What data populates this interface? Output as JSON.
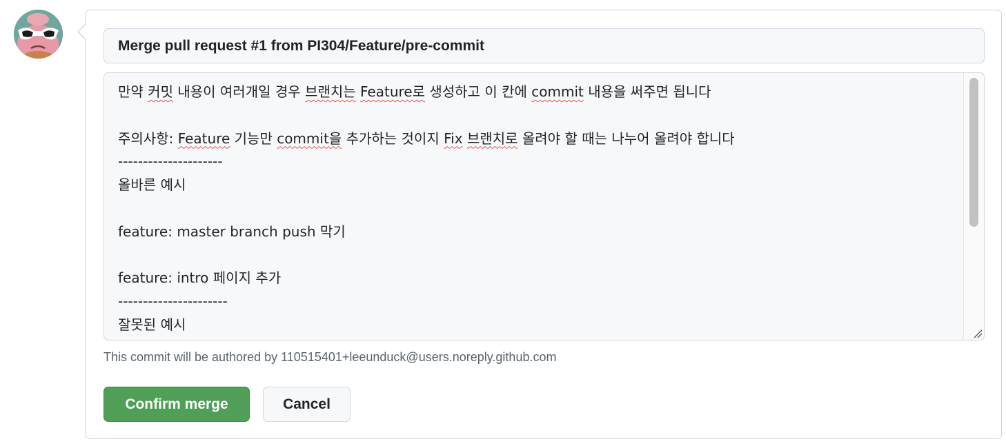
{
  "merge_form": {
    "commit_title": "Merge pull request #1 from PI304/Feature/pre-commit",
    "commit_body_lines": [
      "만약 커밋 내용이 여러개일 경우 브랜치는 Feature로 생성하고 이 칸에 commit 내용을 써주면 됩니다",
      "",
      "주의사항: Feature 기능만 commit을 추가하는 것이지 Fix 브랜치로 올려야 할 때는 나누어 올려야 합니다",
      "---------------------",
      "올바른 예시",
      "",
      "feature: master branch push 막기",
      "",
      "feature: intro 페이지 추가",
      "----------------------",
      "잘못된 예시"
    ],
    "spellcheck_words": [
      "커밋",
      "브랜치는",
      "Feature로",
      "commit",
      "Feature",
      "commit을",
      "Fix",
      "브랜치로"
    ],
    "author_note": "This commit will be authored by 110515401+leeunduck@users.noreply.github.com",
    "confirm_label": "Confirm merge",
    "cancel_label": "Cancel"
  },
  "colors": {
    "confirm_button": "#4f9f57",
    "input_background": "#f6f8fa",
    "border": "#d0d7de",
    "muted_text": "#59636e",
    "spellcheck_underline": "#e5534b"
  }
}
